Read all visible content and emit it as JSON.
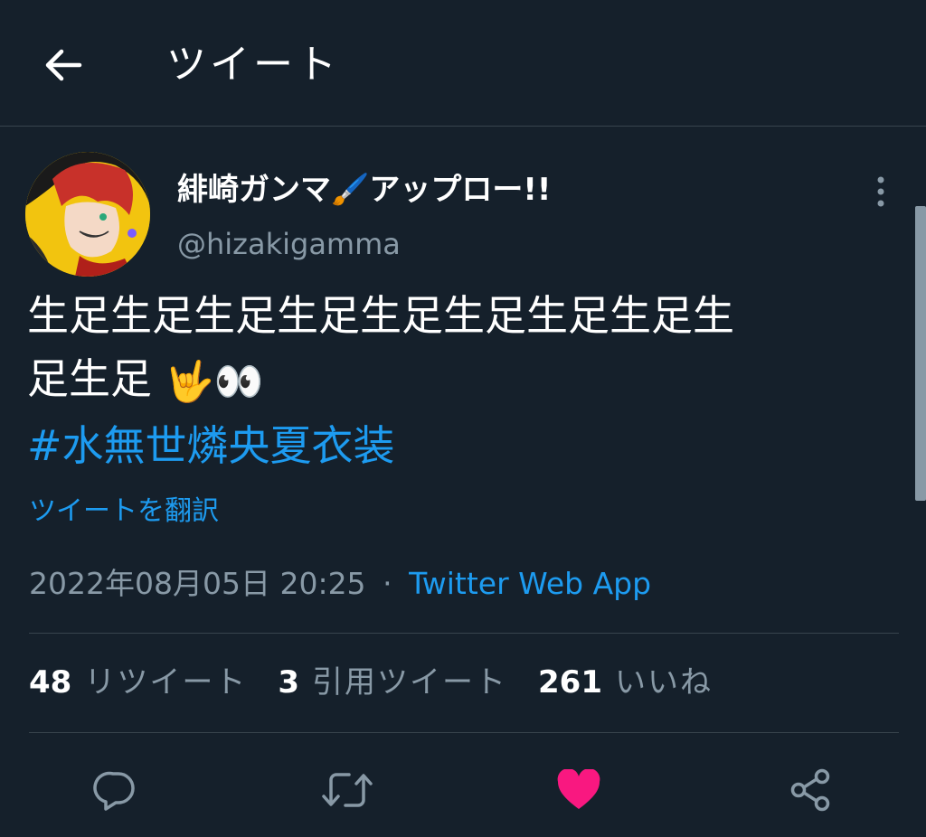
{
  "header": {
    "title": "ツイート"
  },
  "author": {
    "name": "緋崎ガンマ🖌️アップロー!!",
    "handle": "@hizakigamma"
  },
  "tweet": {
    "line1": "生足生足生足生足生足生足生足生足生",
    "line2": "足生足",
    "emoji": "🤟👀",
    "hashtag": "#水無世燐央夏衣装",
    "translate_label": "ツイートを翻訳",
    "timestamp": "2022年08月05日 20:25",
    "separator": "·",
    "source": "Twitter Web App"
  },
  "stats": {
    "retweets_count": "48",
    "retweets_label": "リツイート",
    "quotes_count": "3",
    "quotes_label": "引用ツイート",
    "likes_count": "261",
    "likes_label": "いいね"
  },
  "colors": {
    "background": "#15202b",
    "accent": "#1d9bf0",
    "like": "#f91880",
    "muted": "#8899a6"
  },
  "icons": {
    "back": "arrow-left-icon",
    "more": "more-vertical-icon",
    "reply": "reply-icon",
    "retweet": "retweet-icon",
    "like": "heart-icon",
    "share": "share-icon"
  }
}
